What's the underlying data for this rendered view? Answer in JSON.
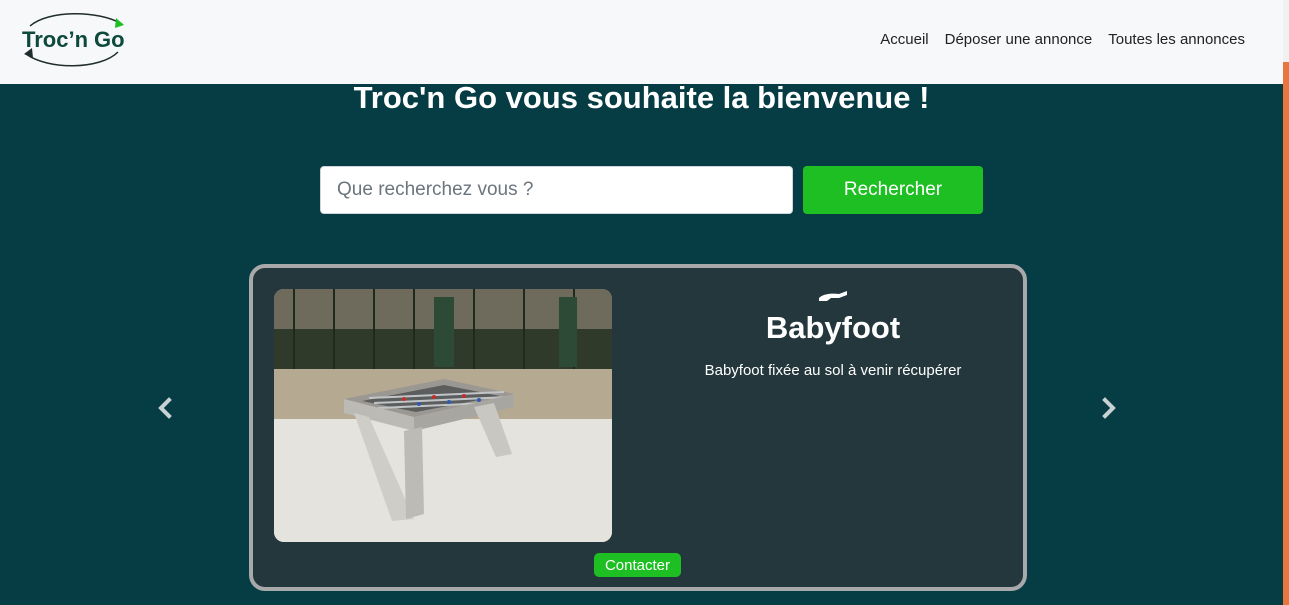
{
  "header": {
    "logo_text": "Troc'n Go",
    "nav": [
      {
        "label": "Accueil"
      },
      {
        "label": "Déposer une annonce"
      },
      {
        "label": "Toutes les annonces"
      }
    ]
  },
  "hero": {
    "title": "Troc'n Go vous souhaite la bienvenue !"
  },
  "search": {
    "placeholder": "Que recherchez vous ?",
    "value": "",
    "button_label": "Rechercher"
  },
  "carousel": {
    "prev_icon": "chevron-left-icon",
    "next_icon": "chevron-right-icon",
    "item": {
      "icon": "giving-hand-icon",
      "title": "Babyfoot",
      "description": "Babyfoot fixée au sol à venir récupérer",
      "contact_label": "Contacter"
    }
  },
  "colors": {
    "background": "#063d44",
    "card": "#24373c",
    "accent_green": "#1ebf22",
    "card_border": "#a7a9ab",
    "scrollbar_thumb": "#e7763f",
    "navbar": "#f7f8fa"
  }
}
